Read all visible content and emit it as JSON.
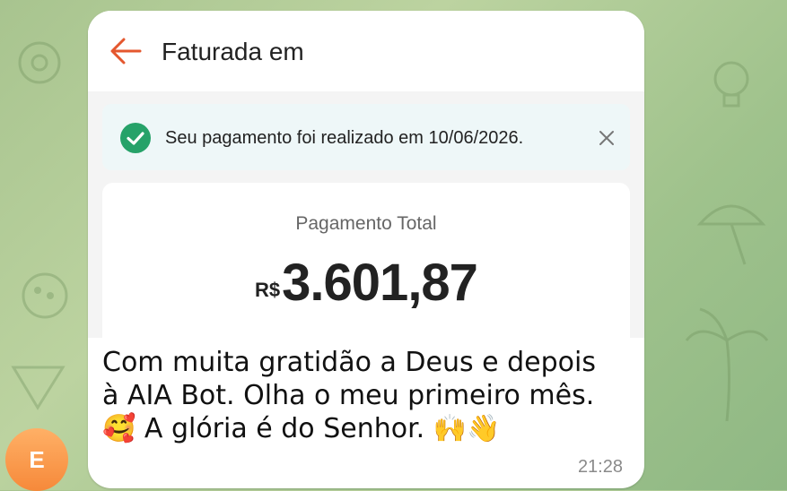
{
  "chat": {
    "sender_initial": "E",
    "avatar_color": "#f6893a",
    "message_time": "21:28",
    "caption_lines": [
      "Com muita gratidão a Deus e depois",
      "à AIA Bot. Olha o meu primeiro mês.",
      "🥰 A glória é do Senhor. 🙌👋"
    ]
  },
  "screenshot": {
    "header": {
      "title": "Faturada em",
      "back_icon": "arrow-left-icon"
    },
    "notice": {
      "text": "Seu pagamento foi realizado em 10/06/2026.",
      "status_icon": "check-circle-icon",
      "close_icon": "close-icon",
      "accent_color": "#26a269"
    },
    "payment": {
      "label": "Pagamento Total",
      "currency": "R$",
      "amount": "3.601,87"
    }
  }
}
